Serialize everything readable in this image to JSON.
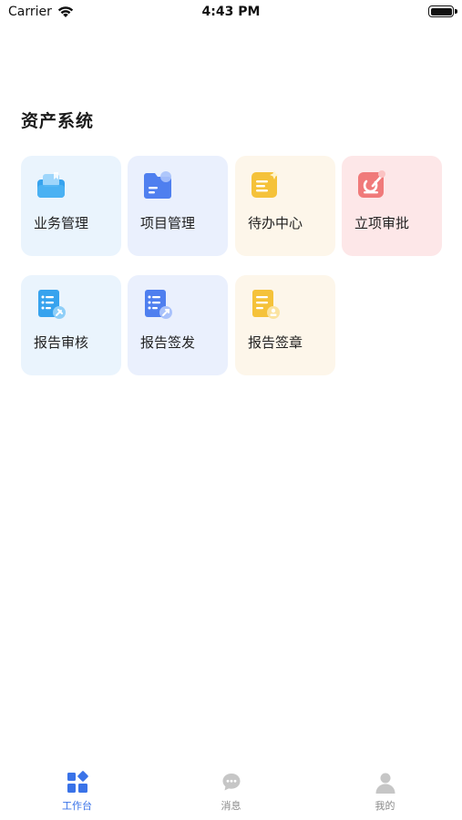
{
  "status_bar": {
    "carrier": "Carrier",
    "time": "4:43 PM"
  },
  "section": {
    "title": "资产系统"
  },
  "cards": [
    {
      "label": "业务管理",
      "icon": "briefcase-icon",
      "color": "#3ea8f0"
    },
    {
      "label": "项目管理",
      "icon": "folder-icon",
      "color": "#4f7fef"
    },
    {
      "label": "待办中心",
      "icon": "todo-icon",
      "color": "#f5c23a"
    },
    {
      "label": "立项审批",
      "icon": "approval-icon",
      "color": "#f07a7a"
    },
    {
      "label": "报告审核",
      "icon": "report-review-icon",
      "color": "#3ea8f0"
    },
    {
      "label": "报告签发",
      "icon": "report-issue-icon",
      "color": "#4f7fef"
    },
    {
      "label": "报告签章",
      "icon": "report-seal-icon",
      "color": "#f5c23a"
    }
  ],
  "tab_bar": {
    "tabs": [
      {
        "label": "工作台",
        "icon": "workbench-icon",
        "active": true
      },
      {
        "label": "消息",
        "icon": "message-icon",
        "active": false
      },
      {
        "label": "我的",
        "icon": "profile-icon",
        "active": false
      }
    ],
    "active_color": "#3a73e8"
  }
}
